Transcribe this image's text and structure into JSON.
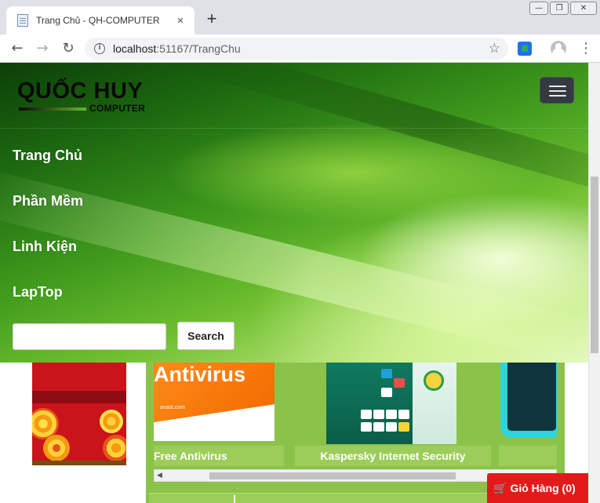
{
  "browser": {
    "tab_title": "Trang Chủ - QH-COMPUTER",
    "tab_close": "×",
    "new_tab": "+",
    "window_controls": {
      "minimize": "—",
      "restore": "❐",
      "close": "✕"
    },
    "nav": {
      "back": "←",
      "forward": "→",
      "reload": "↻"
    },
    "url_host": "localhost",
    "url_path": ":51167/TrangChu",
    "bookmark_icon": "☆",
    "menu_icon": "⋮"
  },
  "site": {
    "logo_main": "QUỐC HUY",
    "logo_sub": "COMPUTER",
    "nav_links": [
      "Trang Chủ",
      "Phần Mềm",
      "Linh Kiện",
      "LapTop"
    ],
    "search": {
      "placeholder": "",
      "button_label": "Search"
    }
  },
  "products": [
    {
      "name": "Free Antivirus",
      "box_title": "Antivirus",
      "box_brand": "avast.com"
    },
    {
      "name": "Kaspersky Internet Security"
    },
    {
      "name": ""
    }
  ],
  "cart": {
    "icon": "🛒",
    "label": "Giỏ Hàng (0)"
  },
  "colors": {
    "accent_green": "#8bc34a",
    "label_green": "#9ccd5a",
    "cart_red": "#e41a1a",
    "hamburger_bg": "#343a40"
  }
}
